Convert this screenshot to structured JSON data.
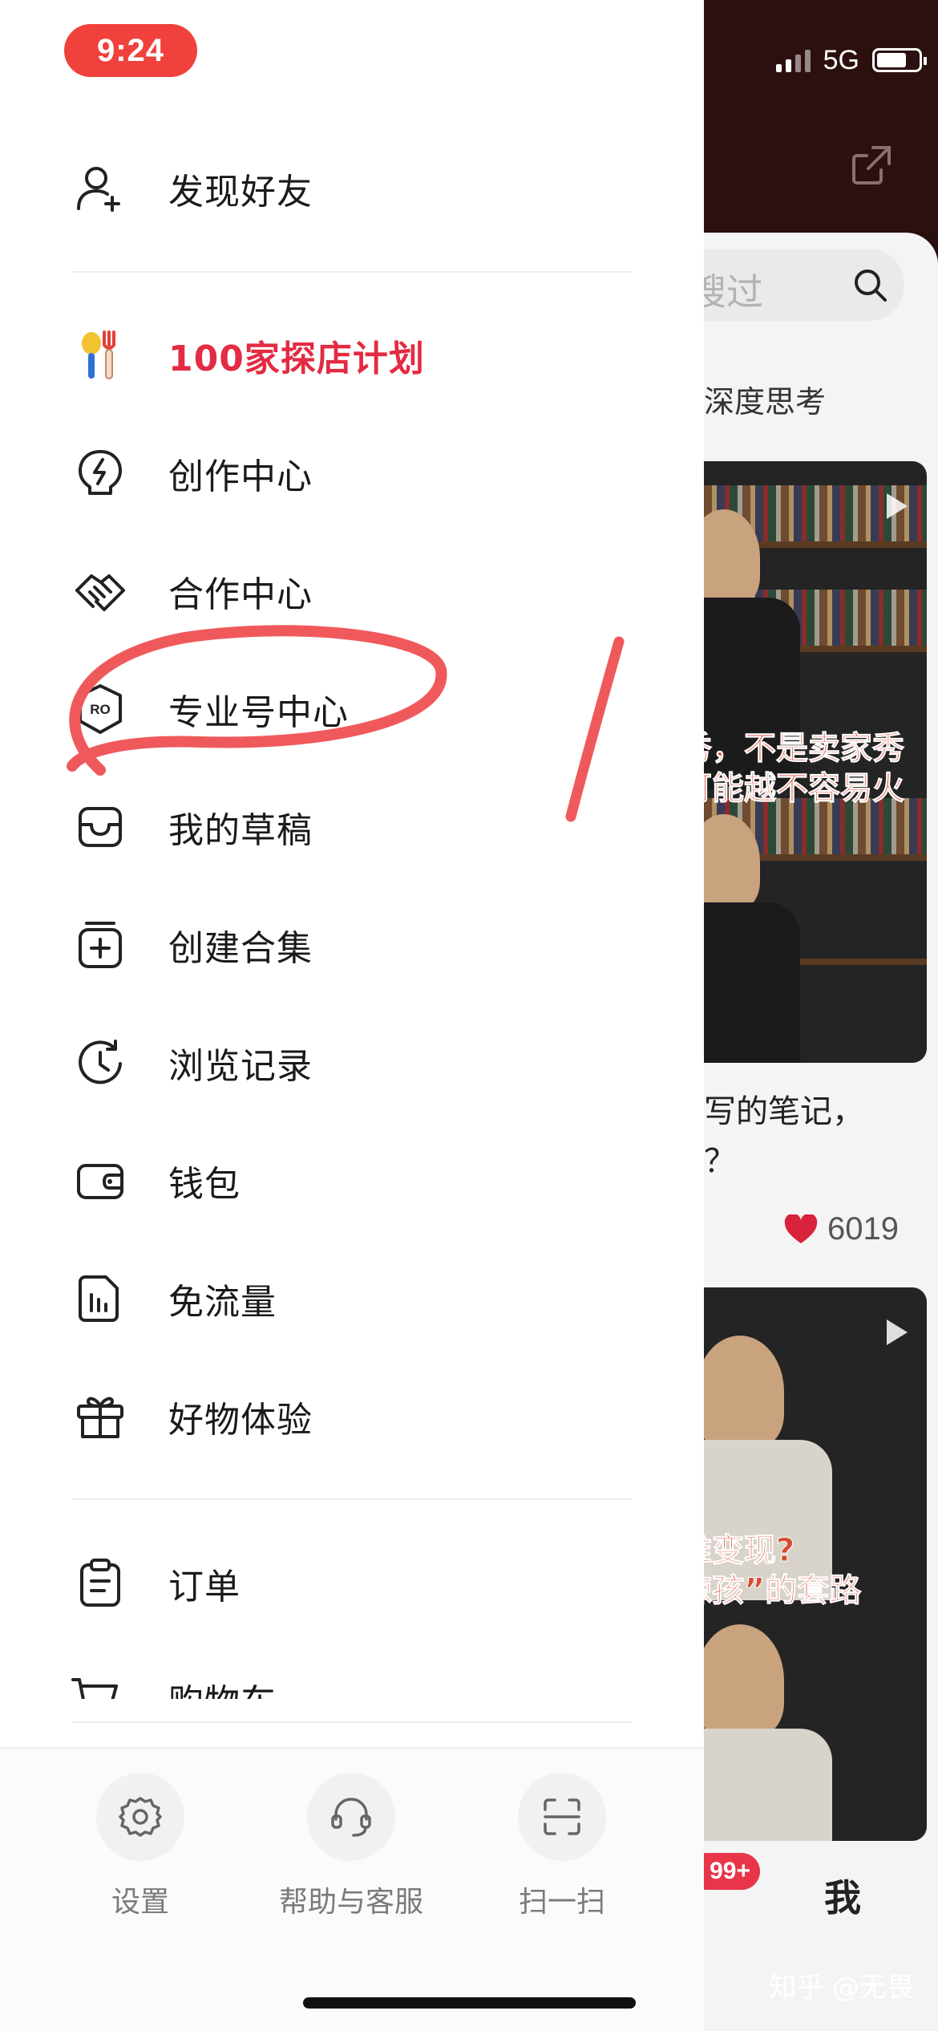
{
  "status": {
    "time": "9:24",
    "network": "5G"
  },
  "drawer": {
    "top_item": {
      "label": "发现好友",
      "icon": "add-user-icon"
    },
    "items": [
      {
        "label": "100家探店计划",
        "icon": "food-utensils-icon",
        "highlight": true
      },
      {
        "label": "创作中心",
        "icon": "lightning-bulb-icon"
      },
      {
        "label": "合作中心",
        "icon": "handshake-icon"
      },
      {
        "label": "专业号中心",
        "icon": "pro-badge-icon",
        "icon_text": "RO"
      },
      {
        "label": "我的草稿",
        "icon": "inbox-icon"
      },
      {
        "label": "创建合集",
        "icon": "add-collection-icon"
      },
      {
        "label": "浏览记录",
        "icon": "history-clock-icon"
      },
      {
        "label": "钱包",
        "icon": "wallet-icon"
      },
      {
        "label": "免流量",
        "icon": "data-chart-icon"
      },
      {
        "label": "好物体验",
        "icon": "gift-icon"
      }
    ],
    "order_item": {
      "label": "订单",
      "icon": "clipboard-icon"
    },
    "partial_item": {
      "label": "购物车",
      "icon": "cart-icon"
    },
    "bottom_tools": [
      {
        "label": "设置",
        "icon": "gear-icon"
      },
      {
        "label": "帮助与客服",
        "icon": "headset-icon"
      },
      {
        "label": "扫一扫",
        "icon": "scan-icon"
      }
    ]
  },
  "background": {
    "search_text": "搜过",
    "tab_label": "深度思考",
    "card1_overlay_line1": "秀，不是卖家秀",
    "card1_overlay_line2": "可能越不容易火",
    "card1_caption_line1": "写的笔记，",
    "card1_caption_line2": "？",
    "card1_likes": "6019",
    "card2_overlay_line1": "难变现?",
    "card2_overlay_line2": "辣孩”的套路",
    "badge_text": "99+",
    "me_tab": "我"
  },
  "watermark": "知乎 @无畏",
  "colors": {
    "accent_red": "#e32b43",
    "time_pill": "#f0413c",
    "annotation": "#f0595b"
  }
}
